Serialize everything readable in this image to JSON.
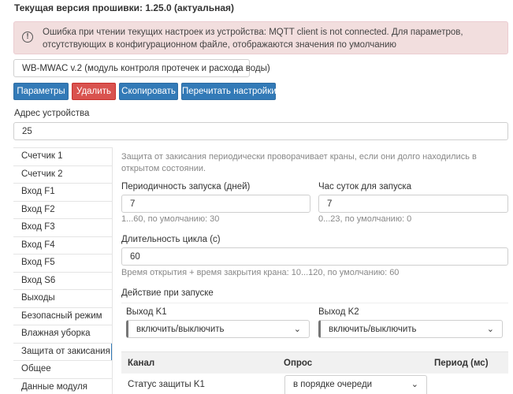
{
  "header": {
    "firmware": "Текущая версия прошивки: 1.25.0 (актуальная)"
  },
  "alert": {
    "icon": "info-circle-icon",
    "text": "Ошибка при чтении текущих настроек из устройства: MQTT client is not connected. Для параметров, отсутствующих в конфигурационном файле, отображаются значения по умолчанию"
  },
  "device_select": {
    "value": "WB-MWAC v.2 (модуль контроля протечек и расхода воды)"
  },
  "toolbar": {
    "params_label": "Параметры",
    "delete_label": "Удалить",
    "copy_label": "Скопировать",
    "reread_label": "Перечитать настройки"
  },
  "address": {
    "label": "Адрес устройства",
    "value": "25"
  },
  "sidebar": {
    "items": [
      {
        "label": "Счетчик 1"
      },
      {
        "label": "Счетчик 2"
      },
      {
        "label": "Вход F1"
      },
      {
        "label": "Вход F2"
      },
      {
        "label": "Вход F3"
      },
      {
        "label": "Вход F4"
      },
      {
        "label": "Вход F5"
      },
      {
        "label": "Вход S6"
      },
      {
        "label": "Выходы"
      },
      {
        "label": "Безопасный режим"
      },
      {
        "label": "Влажная уборка"
      },
      {
        "label": "Защита от закисания"
      },
      {
        "label": "Общее"
      },
      {
        "label": "Данные модуля"
      }
    ]
  },
  "panel": {
    "description": "Защита от закисания периодически проворачивает краны, если они долго находились в открытом состоянии.",
    "period": {
      "label": "Периодичность запуска (дней)",
      "value": "7",
      "hint": "1...60, по умолчанию: 30"
    },
    "hour": {
      "label": "Час суток для запуска",
      "value": "7",
      "hint": "0...23, по умолчанию: 0"
    },
    "duration": {
      "label": "Длительность цикла (с)",
      "value": "60",
      "hint": "Время открытия + время закрытия крана: 10...120, по умолчанию: 60"
    },
    "action": {
      "title": "Действие при запуске",
      "k1": {
        "label": "Выход K1",
        "value": "включить/выключить"
      },
      "k2": {
        "label": "Выход K2",
        "value": "включить/выключить"
      }
    },
    "table": {
      "columns": [
        "Канал",
        "Опрос",
        "Период (мс)"
      ],
      "rows": [
        {
          "channel": "Статус защиты K1",
          "poll": "в порядке очереди"
        }
      ]
    }
  },
  "colors": {
    "primary": "#337ab7",
    "danger": "#d9534f",
    "alert_bg": "#f2dede"
  }
}
